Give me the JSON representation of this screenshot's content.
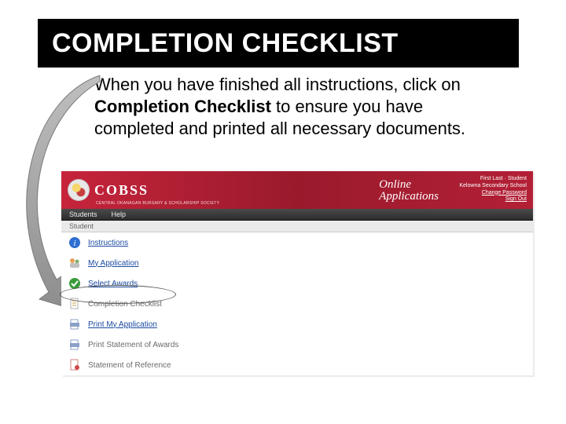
{
  "title": "COMPLETION CHECKLIST",
  "body": {
    "pre": "When you have finished all instructions, click on ",
    "bold": "Completion Checklist",
    "post": " to ensure you have completed and printed all necessary documents."
  },
  "app": {
    "logo_text": "COBSS",
    "logo_sub": "CENTRAL OKANAGAN BURSARY & SCHOLARSHIP SOCIETY",
    "banner_title_line1": "Online",
    "banner_title_line2": "Applications",
    "user": {
      "line1": "First Last · Student",
      "line2": "Kelowna Secondary School",
      "change_pw": "Change Password",
      "signout": "Sign Out"
    },
    "menu": {
      "students": "Students",
      "help": "Help"
    },
    "submenu": "Student",
    "sidebar": [
      {
        "label": "Instructions",
        "link": true,
        "icon": "info"
      },
      {
        "label": "My Application",
        "link": true,
        "icon": "people"
      },
      {
        "label": "Select Awards",
        "link": true,
        "icon": "check"
      },
      {
        "label": "Completion Checklist",
        "link": false,
        "icon": "doc"
      },
      {
        "label": "Print My Application",
        "link": true,
        "icon": "print"
      },
      {
        "label": "Print Statement of Awards",
        "link": false,
        "icon": "print"
      },
      {
        "label": "Statement of Reference",
        "link": false,
        "icon": "ref"
      }
    ]
  }
}
